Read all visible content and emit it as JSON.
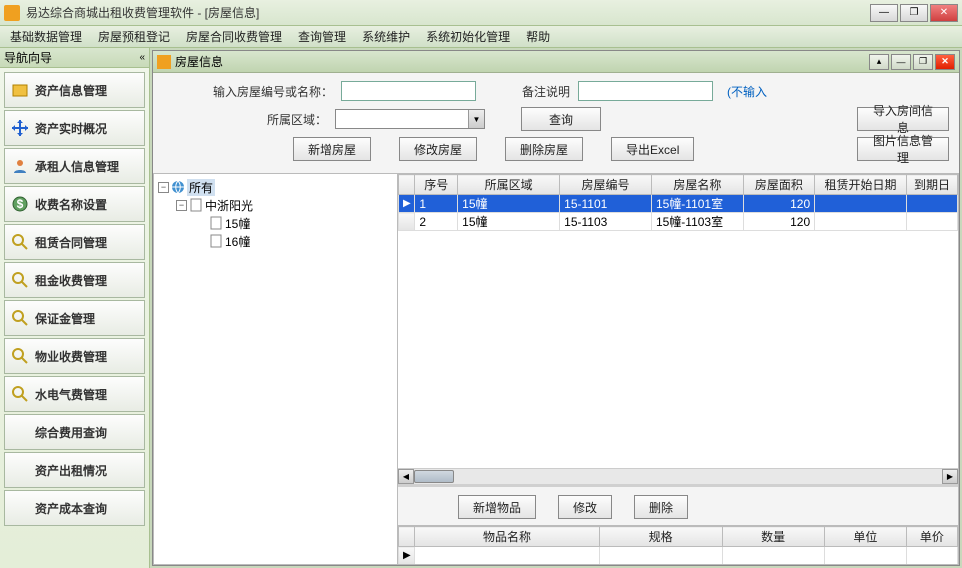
{
  "window": {
    "title": "易达综合商城出租收费管理软件    - [房屋信息]"
  },
  "menu": [
    "基础数据管理",
    "房屋预租登记",
    "房屋合同收费管理",
    "查询管理",
    "系统维护",
    "系统初始化管理",
    "帮助"
  ],
  "nav": {
    "header": "导航向导",
    "items": [
      "资产信息管理",
      "资产实时概况",
      "承租人信息管理",
      "收费名称设置",
      "租赁合同管理",
      "租金收费管理",
      "保证金管理",
      "物业收费管理",
      "水电气费管理",
      "综合费用查询",
      "资产出租情况",
      "资产成本查询"
    ]
  },
  "child": {
    "title": "房屋信息"
  },
  "form": {
    "label_search": "输入房屋编号或名称：",
    "label_remark": "备注说明",
    "no_input": "(不输入",
    "label_region": "所属区域：",
    "btn_query": "查询",
    "btn_import": "导入房间信息",
    "btn_add": "新增房屋",
    "btn_edit": "修改房屋",
    "btn_delete": "删除房屋",
    "btn_export": "导出Excel",
    "btn_pic": "图片信息管理"
  },
  "tree": {
    "root": "所有",
    "child1": "中浙阳光",
    "leaf1": "15幢",
    "leaf2": "16幢"
  },
  "grid": {
    "headers": [
      "序号",
      "所属区域",
      "房屋编号",
      "房屋名称",
      "房屋面积",
      "租赁开始日期",
      "到期日"
    ],
    "rows": [
      {
        "seq": "1",
        "region": "15幢",
        "code": "15-1101",
        "name": "15幢-1101室",
        "area": "120",
        "start": "",
        "end": ""
      },
      {
        "seq": "2",
        "region": "15幢",
        "code": "15-1103",
        "name": "15幢-1103室",
        "area": "120",
        "start": "",
        "end": ""
      }
    ]
  },
  "bottom": {
    "btn_add": "新增物品",
    "btn_edit": "修改",
    "btn_delete": "删除",
    "headers": [
      "物品名称",
      "规格",
      "数量",
      "单位",
      "单价"
    ]
  }
}
